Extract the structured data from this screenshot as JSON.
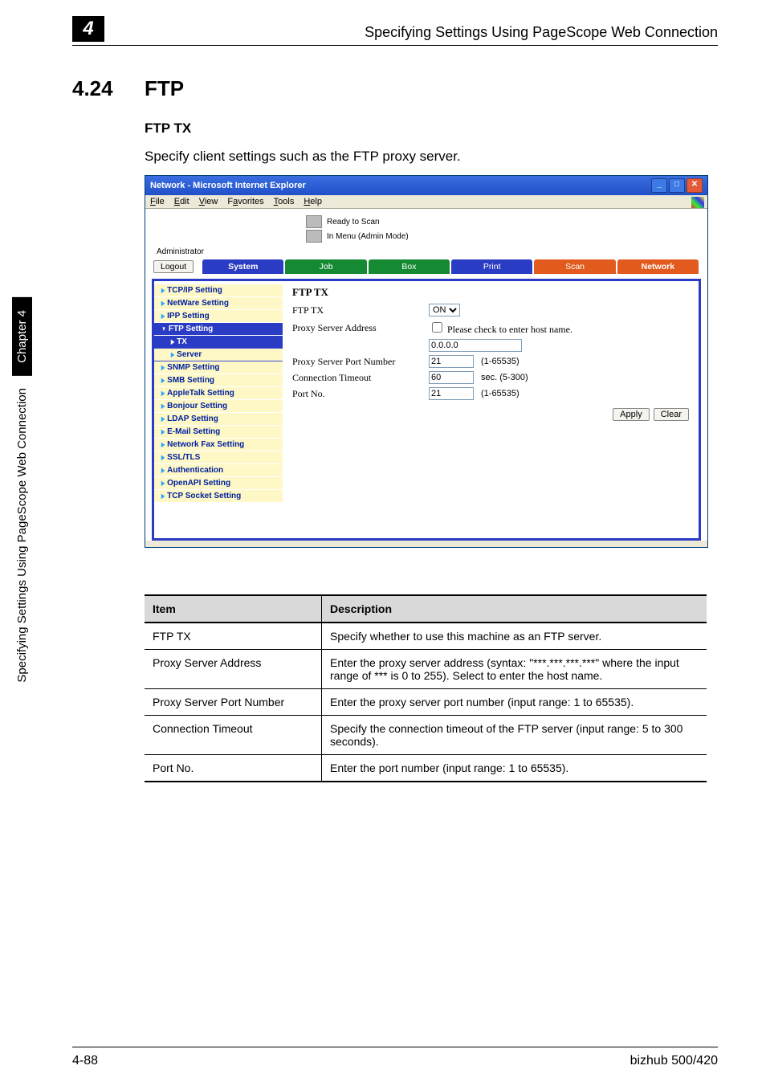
{
  "page": {
    "chapter_tab": "4",
    "chapter_header": "Specifying Settings Using PageScope Web Connection",
    "section_number": "4.24",
    "section_title": "FTP",
    "sub_head": "FTP TX",
    "intro": "Specify client settings such as the FTP proxy server."
  },
  "side": {
    "black": "Chapter 4",
    "white": "Specifying Settings Using PageScope Web Connection"
  },
  "ie": {
    "title": "Network - Microsoft Internet Explorer",
    "menu": {
      "file": "File",
      "edit": "Edit",
      "view": "View",
      "fav": "Favorites",
      "tools": "Tools",
      "help": "Help"
    },
    "status1": "Ready to Scan",
    "status2": "In Menu (Admin Mode)",
    "admin": "Administrator",
    "logout": "Logout",
    "tabs": {
      "system": "System",
      "job": "Job",
      "box": "Box",
      "print": "Print",
      "scan": "Scan",
      "network": "Network"
    }
  },
  "nav": {
    "tcpip": "TCP/IP Setting",
    "netware": "NetWare Setting",
    "ipp": "IPP Setting",
    "ftp": "FTP Setting",
    "tx": "TX",
    "server": "Server",
    "snmp": "SNMP Setting",
    "smb": "SMB Setting",
    "appletalk": "AppleTalk Setting",
    "bonjour": "Bonjour Setting",
    "ldap": "LDAP Setting",
    "email": "E-Mail Setting",
    "netfax": "Network Fax Setting",
    "ssl": "SSL/TLS",
    "auth": "Authentication",
    "openapi": "OpenAPI Setting",
    "tcpsock": "TCP Socket Setting"
  },
  "form": {
    "heading": "FTP TX",
    "ftptx_label": "FTP TX",
    "ftptx_value": "ON",
    "proxy_addr_label": "Proxy Server Address",
    "hostname_chk": "Please check to enter host name.",
    "proxy_addr_value": "0.0.0.0",
    "proxy_port_label": "Proxy Server Port Number",
    "proxy_port_value": "21",
    "proxy_port_range": "(1-65535)",
    "conn_to_label": "Connection Timeout",
    "conn_to_value": "60",
    "conn_to_range": "sec. (5-300)",
    "portno_label": "Port No.",
    "portno_value": "21",
    "portno_range": "(1-65535)",
    "apply": "Apply",
    "clear": "Clear"
  },
  "table": {
    "h_item": "Item",
    "h_desc": "Description",
    "rows": [
      {
        "item": "FTP TX",
        "desc": "Specify whether to use this machine as an FTP server."
      },
      {
        "item": "Proxy Server Address",
        "desc": "Enter the proxy server address (syntax: \"***.***.***.***\" where the input range of *** is 0 to 255). Select to enter the host name."
      },
      {
        "item": "Proxy Server Port Number",
        "desc": "Enter the proxy server port number (input range: 1 to 65535)."
      },
      {
        "item": "Connection Timeout",
        "desc": "Specify the connection timeout of the FTP server (input range: 5 to 300 seconds)."
      },
      {
        "item": "Port No.",
        "desc": "Enter the port number (input range: 1 to 65535)."
      }
    ]
  },
  "footer": {
    "left": "4-88",
    "right": "bizhub 500/420"
  }
}
